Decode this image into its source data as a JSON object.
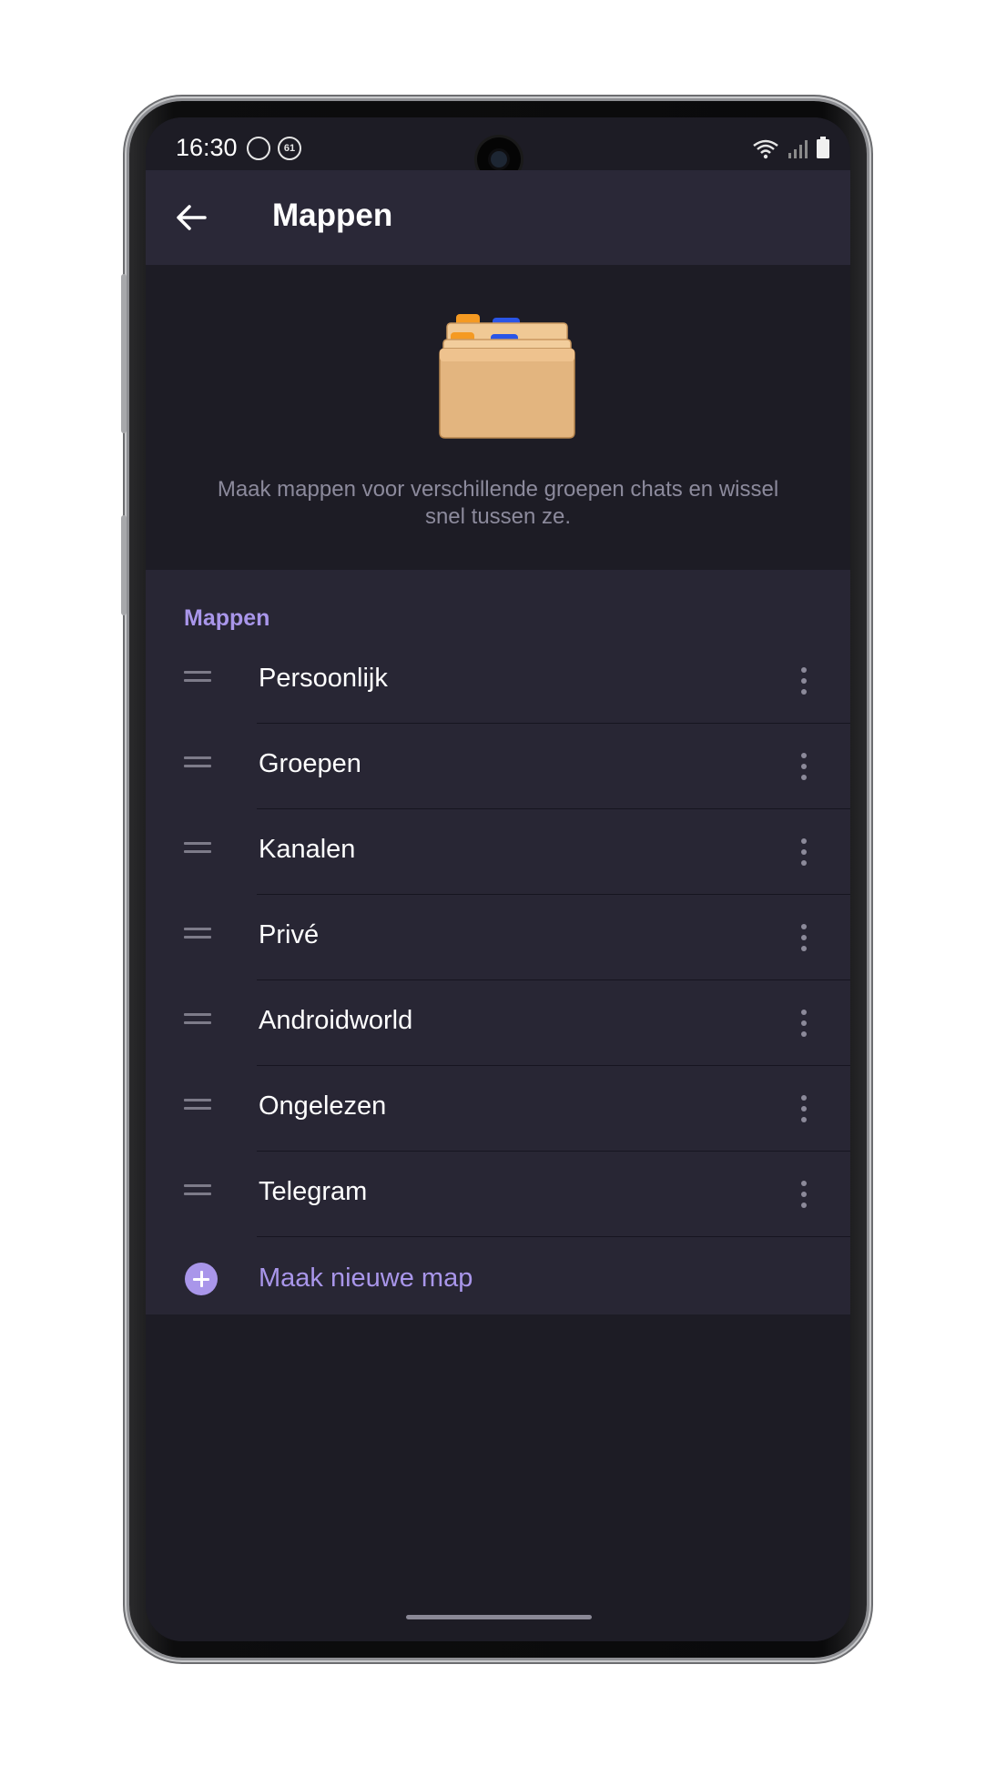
{
  "status_bar": {
    "time": "16:30",
    "notification_badge": "61",
    "icons": [
      "sync-icon",
      "badge-61-icon",
      "wifi-icon",
      "signal-icon",
      "battery-icon"
    ]
  },
  "app_bar": {
    "back_icon": "arrow-left-icon",
    "title": "Mappen"
  },
  "hero": {
    "illustration": "file-folders-icon",
    "description": "Maak mappen voor verschillende groepen chats en wissel snel tussen ze."
  },
  "folders": {
    "section_title": "Mappen",
    "items": [
      {
        "name": "Persoonlijk"
      },
      {
        "name": "Groepen"
      },
      {
        "name": "Kanalen"
      },
      {
        "name": "Privé"
      },
      {
        "name": "Androidworld"
      },
      {
        "name": "Ongelezen"
      },
      {
        "name": "Telegram"
      }
    ],
    "add_label": "Maak nieuwe map"
  },
  "colors": {
    "accent": "#a996ea",
    "app_bar_bg": "#2a2837",
    "screen_bg": "#1d1c25",
    "section_bg": "#282634",
    "secondary_text": "#8c8a9c"
  }
}
